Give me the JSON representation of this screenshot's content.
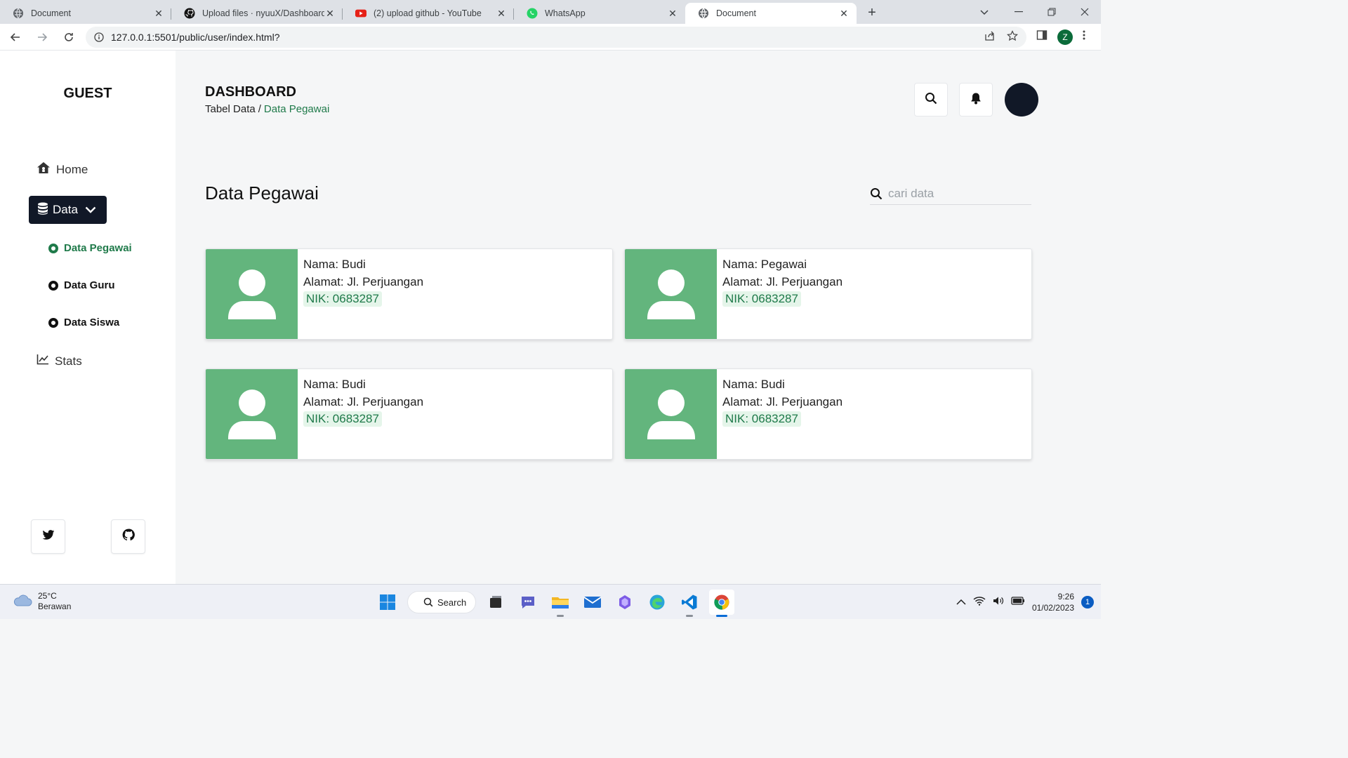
{
  "browser": {
    "tabs": [
      {
        "title": "Document",
        "icon": "globe-icon",
        "active": false
      },
      {
        "title": "Upload files · nyuuX/Dashboard",
        "icon": "github-icon",
        "active": false
      },
      {
        "title": "(2) upload github - YouTube",
        "icon": "youtube-icon",
        "active": false
      },
      {
        "title": "WhatsApp",
        "icon": "whatsapp-icon",
        "active": false
      },
      {
        "title": "Document",
        "icon": "globe-icon",
        "active": true
      }
    ],
    "url": "127.0.0.1:5501/public/user/index.html?",
    "profile_initial": "Z"
  },
  "sidebar": {
    "brand": "GUEST",
    "home_label": "Home",
    "data_label": "Data",
    "submenu": [
      {
        "label": "Data Pegawai",
        "active": true
      },
      {
        "label": "Data Guru",
        "active": false
      },
      {
        "label": "Data Siswa",
        "active": false
      }
    ],
    "stats_label": "Stats"
  },
  "header": {
    "title": "DASHBOARD",
    "breadcrumb_root": "Tabel Data",
    "breadcrumb_sep": "/",
    "breadcrumb_current": "Data Pegawai"
  },
  "main": {
    "section_title": "Data Pegawai",
    "search_placeholder": "cari data",
    "cards": [
      {
        "nama": "Nama: Budi",
        "alamat": "Alamat: Jl. Perjuangan",
        "nik": "NIK: 0683287"
      },
      {
        "nama": "Nama: Pegawai",
        "alamat": "Alamat: Jl. Perjuangan",
        "nik": "NIK: 0683287"
      },
      {
        "nama": "Nama: Budi",
        "alamat": "Alamat: Jl. Perjuangan",
        "nik": "NIK: 0683287"
      },
      {
        "nama": "Nama: Budi",
        "alamat": "Alamat: Jl. Perjuangan",
        "nik": "NIK: 0683287"
      }
    ]
  },
  "taskbar": {
    "weather_temp": "25°C",
    "weather_desc": "Berawan",
    "search_label": "Search",
    "time": "9:26",
    "date": "01/02/2023",
    "notification_count": "1"
  },
  "colors": {
    "accent_green": "#1f7a4a",
    "card_photo_bg": "#63b57d",
    "nav_active_bg": "#111827"
  }
}
